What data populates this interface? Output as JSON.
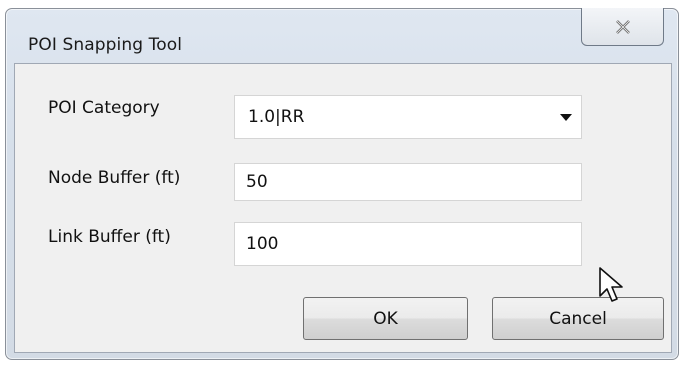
{
  "window": {
    "title": "POI Snapping Tool",
    "close_icon": "close-icon"
  },
  "form": {
    "poi_category": {
      "label": "POI Category",
      "selected": "1.0|RR"
    },
    "node_buffer": {
      "label": "Node Buffer (ft)",
      "value": "50"
    },
    "link_buffer": {
      "label": "Link Buffer (ft)",
      "value": "100"
    }
  },
  "buttons": {
    "ok": "OK",
    "cancel": "Cancel"
  },
  "colors": {
    "frame": "#d6dfea",
    "client": "#f0f0f0"
  },
  "cursor_icon": "mouse-pointer-icon"
}
